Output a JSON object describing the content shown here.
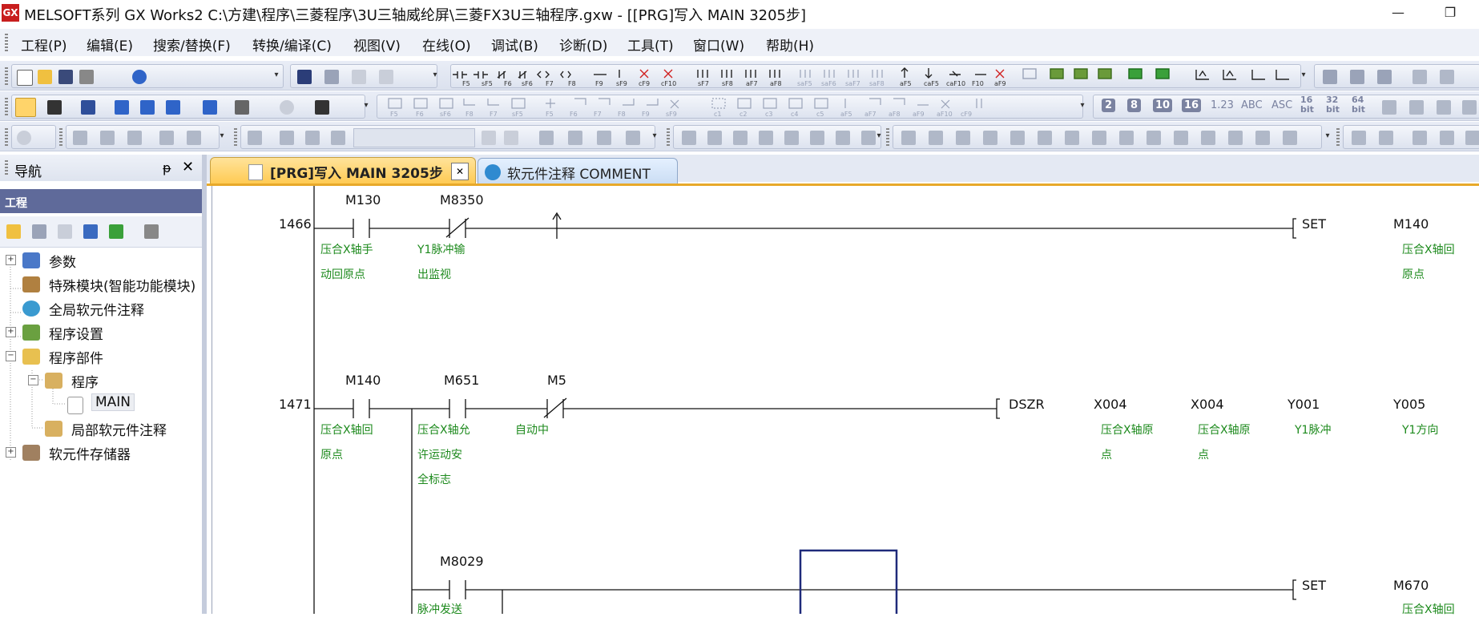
{
  "window": {
    "title": "MELSOFT系列 GX Works2 C:\\方建\\程序\\三菱程序\\3U三轴威纶屏\\三菱FX3U三轴程序.gxw - [[PRG]写入 MAIN 3205步]",
    "app_icon_text": "GX",
    "minimize": "—",
    "restore": "❐"
  },
  "menu": [
    "工程(P)",
    "编辑(E)",
    "搜索/替换(F)",
    "转换/编译(C)",
    "视图(V)",
    "在线(O)",
    "调试(B)",
    "诊断(D)",
    "工具(T)",
    "窗口(W)",
    "帮助(H)"
  ],
  "toolbar": {
    "key_labels_row1": [
      "F5",
      "sF5",
      "F6",
      "sF6",
      "F7",
      "F8",
      "F9",
      "sF9",
      "cF9",
      "cF10",
      "sF7",
      "sF8",
      "aF7",
      "aF8",
      "saF5",
      "saF6",
      "saF7",
      "saF8",
      "aF5",
      "caF5",
      "caF10",
      "F10",
      "aF9"
    ],
    "key_labels_row2": [
      "F5",
      "F6",
      "sF6",
      "F8",
      "F7",
      "sF5",
      "F5",
      "F6",
      "F7",
      "F8",
      "F9",
      "sF9",
      "c1",
      "c2",
      "c3",
      "c4",
      "c5",
      "aF5",
      "aF7",
      "aF8",
      "aF9",
      "aF10",
      "cF9"
    ],
    "number_buttons": [
      "2",
      "8",
      "10",
      "16",
      "1.23",
      "ABC",
      "ASC",
      "16 bit",
      "32 bit",
      "64 bit"
    ]
  },
  "nav": {
    "title": "导航",
    "pin": "ᵽ",
    "close": "✕",
    "project_header": "工程",
    "tree": [
      {
        "label": "参数",
        "level": 0,
        "expander": "+"
      },
      {
        "label": "特殊模块(智能功能模块)",
        "level": 0,
        "expander": ""
      },
      {
        "label": "全局软元件注释",
        "level": 0,
        "expander": ""
      },
      {
        "label": "程序设置",
        "level": 0,
        "expander": "+"
      },
      {
        "label": "程序部件",
        "level": 0,
        "expander": "−"
      },
      {
        "label": "程序",
        "level": 1,
        "expander": "−"
      },
      {
        "label": "MAIN",
        "level": 2,
        "expander": ""
      },
      {
        "label": "局部软元件注释",
        "level": 1,
        "expander": ""
      },
      {
        "label": "软元件存储器",
        "level": 0,
        "expander": "+"
      }
    ]
  },
  "tabs": [
    {
      "label": "[PRG]写入 MAIN 3205步",
      "active": true,
      "close": "✕"
    },
    {
      "label": "软元件注释 COMMENT",
      "active": false
    }
  ],
  "ladder": {
    "rungs": [
      {
        "step": "1466",
        "contacts": [
          {
            "device": "M130",
            "type": "NO",
            "comment": [
              "压合X轴手",
              "动回原点"
            ]
          },
          {
            "device": "M8350",
            "type": "NC",
            "comment": [
              "Y1脉冲输",
              "出监视"
            ]
          }
        ],
        "rising_mark": "↑",
        "instruction": "SET",
        "operands": [
          {
            "device": "M140",
            "comment": [
              "压合X轴回",
              "原点"
            ]
          }
        ]
      },
      {
        "step": "1471",
        "contacts": [
          {
            "device": "M140",
            "type": "NO",
            "comment": [
              "压合X轴回",
              "原点"
            ]
          },
          {
            "device": "M651",
            "type": "NO",
            "comment": [
              "压合X轴允",
              "许运动安",
              "全标志"
            ]
          },
          {
            "device": "M5",
            "type": "NC",
            "comment": [
              "自动中"
            ]
          }
        ],
        "instruction": "DSZR",
        "operands": [
          {
            "device": "X004",
            "comment": [
              "压合X轴原",
              "点"
            ]
          },
          {
            "device": "X004",
            "comment": [
              "压合X轴原",
              "点"
            ]
          },
          {
            "device": "Y001",
            "comment": [
              "Y1脉冲"
            ]
          },
          {
            "device": "Y005",
            "comment": [
              "Y1方向"
            ]
          }
        ]
      },
      {
        "step": "",
        "contacts": [
          {
            "device": "M8029",
            "type": "NO",
            "comment": [
              "脉冲发送"
            ]
          }
        ],
        "instruction": "SET",
        "operands": [
          {
            "device": "M670",
            "comment": [
              "压合X轴回"
            ]
          }
        ]
      }
    ]
  },
  "colors": {
    "comment_text": "#1d8a1d",
    "cursor_box": "#1f2a7a",
    "active_tab": "#ffc94f",
    "nav_header": "#5f6a9a"
  }
}
